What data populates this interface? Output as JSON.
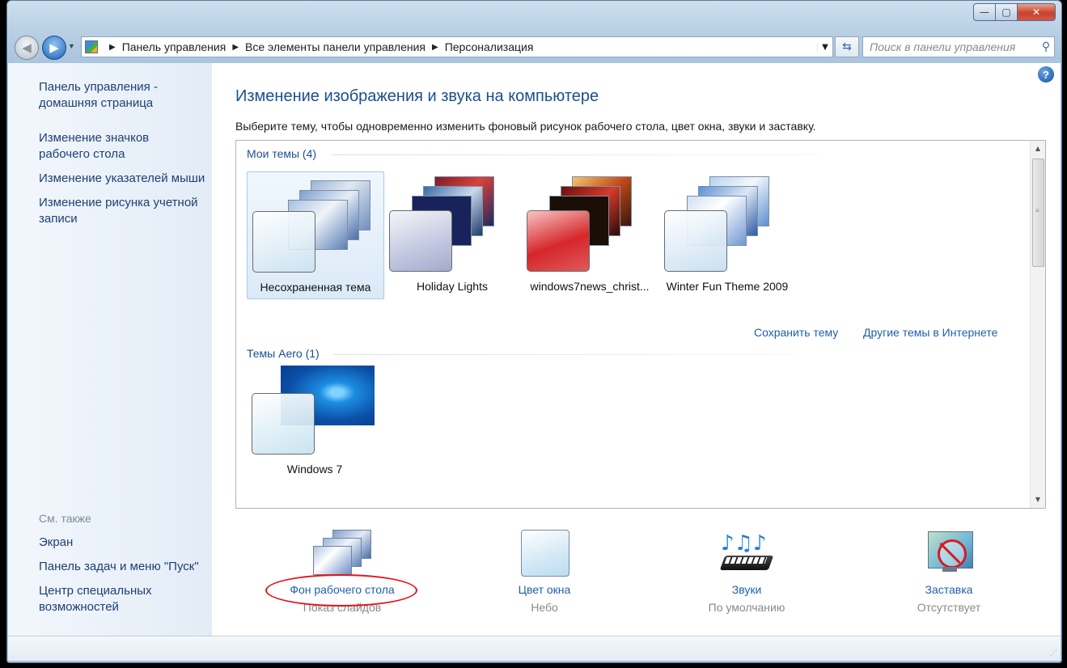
{
  "window": {
    "controls": {
      "minimize": "—",
      "maximize": "▢",
      "close": "✕"
    }
  },
  "nav": {
    "back_icon": "arrow-left",
    "forward_icon": "arrow-right",
    "breadcrumb": [
      "Панель управления",
      "Все элементы панели управления",
      "Персонализация"
    ],
    "search_placeholder": "Поиск в панели управления"
  },
  "sidebar": {
    "links": [
      "Панель управления - домашняя страница",
      "Изменение значков рабочего стола",
      "Изменение указателей мыши",
      "Изменение рисунка учетной записи"
    ],
    "see_also_label": "См. также",
    "see_also": [
      "Экран",
      "Панель задач и меню \"Пуск\"",
      "Центр специальных возможностей"
    ]
  },
  "main": {
    "title": "Изменение изображения и звука на компьютере",
    "subtitle": "Выберите тему, чтобы одновременно изменить фоновый рисунок рабочего стола, цвет окна, звуки и заставку.",
    "my_themes_label": "Мои темы (4)",
    "my_themes": [
      {
        "name": "Несохраненная тема",
        "selected": true
      },
      {
        "name": "Holiday Lights",
        "selected": false
      },
      {
        "name": "windows7news_christ...",
        "selected": false
      },
      {
        "name": "Winter Fun Theme 2009",
        "selected": false
      }
    ],
    "save_theme_link": "Сохранить тему",
    "more_themes_link": "Другие темы в Интернете",
    "aero_label": "Темы Aero (1)",
    "aero_themes": [
      {
        "name": "Windows 7"
      }
    ]
  },
  "bottom": {
    "items": [
      {
        "label": "Фон рабочего стола",
        "value": "Показ слайдов",
        "icon": "desktop-background-icon"
      },
      {
        "label": "Цвет окна",
        "value": "Небо",
        "icon": "window-color-icon"
      },
      {
        "label": "Звуки",
        "value": "По умолчанию",
        "icon": "sounds-icon"
      },
      {
        "label": "Заставка",
        "value": "Отсутствует",
        "icon": "screensaver-icon"
      }
    ]
  },
  "colors": {
    "link": "#1e5fae",
    "heading": "#1d4e8f",
    "highlight_ellipse": "#e5121b"
  }
}
